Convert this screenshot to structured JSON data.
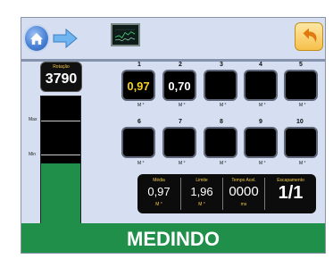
{
  "rotation": {
    "label": "Rotação",
    "value": "3790"
  },
  "gauge": {
    "max_label": "Max",
    "min_label": "Min",
    "level": 0.5
  },
  "cells": [
    {
      "number": "1",
      "value": "0,97",
      "unit": "M °",
      "color": "#f5d020"
    },
    {
      "number": "2",
      "value": "0,70",
      "unit": "M °",
      "color": "#ffffff"
    },
    {
      "number": "3",
      "value": "",
      "unit": "M °"
    },
    {
      "number": "4",
      "value": "",
      "unit": "M °"
    },
    {
      "number": "5",
      "value": "",
      "unit": "M °"
    },
    {
      "number": "6",
      "value": "",
      "unit": "M °"
    },
    {
      "number": "7",
      "value": "",
      "unit": "M °"
    },
    {
      "number": "8",
      "value": "",
      "unit": "M °"
    },
    {
      "number": "9",
      "value": "",
      "unit": "M °"
    },
    {
      "number": "10",
      "value": "",
      "unit": "M °"
    }
  ],
  "stats": {
    "media": {
      "label": "Média",
      "value": "0,97",
      "unit": "M °"
    },
    "limite": {
      "label": "Limite",
      "value": "1,96",
      "unit": "M °"
    },
    "tempo": {
      "label": "Tempo Acel.",
      "value": "0000",
      "unit": "ms"
    },
    "escapamento": {
      "label": "Escapamento",
      "value": "1/1"
    }
  },
  "status": {
    "text": "MEDINDO",
    "color": "#1f8f4a"
  },
  "toolbar": {
    "home_icon": "home-icon",
    "forward_icon": "arrow-right-icon",
    "graph_icon": "graph-icon",
    "back_icon": "return-icon"
  }
}
